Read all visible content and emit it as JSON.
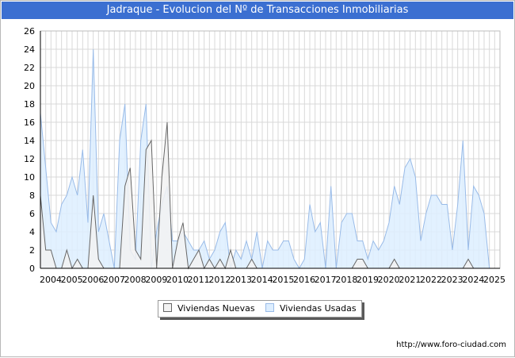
{
  "title": "Jadraque - Evolucion del Nº de Transacciones Inmobiliarias",
  "footer": "http://www.foro-ciudad.com",
  "colors": {
    "title_bg": "#3b6fd1",
    "nuevas_fill": "#f2f2f2",
    "nuevas_line": "#666666",
    "usadas_fill": "#ddeeff",
    "usadas_line": "#99bbe8",
    "grid": "#d9d9d9"
  },
  "chart_data": {
    "type": "area",
    "title": "Jadraque - Evolucion del Nº de Transacciones Inmobiliarias",
    "xlabel": "",
    "ylabel": "",
    "ylim": [
      0,
      26
    ],
    "yticks": [
      0,
      2,
      4,
      6,
      8,
      10,
      12,
      14,
      16,
      18,
      20,
      22,
      24,
      26
    ],
    "xlim": [
      2004,
      2025.75
    ],
    "xticks": [
      "2004",
      "2005",
      "2006",
      "2007",
      "2008",
      "2009",
      "2010",
      "2011",
      "2012",
      "2013",
      "2014",
      "2015",
      "2016",
      "2017",
      "2018",
      "2019",
      "2020",
      "2021",
      "2022",
      "2023",
      "2024",
      "2025"
    ],
    "grid": true,
    "legend_position": "bottom",
    "series": [
      {
        "name": "Viviendas Nuevas",
        "x": [
          2004,
          2004.25,
          2004.5,
          2004.75,
          2005,
          2005.25,
          2005.5,
          2005.75,
          2006,
          2006.25,
          2006.5,
          2006.75,
          2007,
          2007.25,
          2007.5,
          2007.75,
          2008,
          2008.25,
          2008.5,
          2008.75,
          2009,
          2009.25,
          2009.5,
          2009.75,
          2010,
          2010.25,
          2010.5,
          2010.75,
          2011,
          2011.25,
          2011.5,
          2011.75,
          2012,
          2012.25,
          2012.5,
          2012.75,
          2013,
          2013.25,
          2013.5,
          2013.75,
          2014,
          2014.25,
          2014.5,
          2014.75,
          2015,
          2015.25,
          2015.5,
          2015.75,
          2016,
          2016.25,
          2016.5,
          2016.75,
          2017,
          2017.25,
          2017.5,
          2017.75,
          2018,
          2018.25,
          2018.5,
          2018.75,
          2019,
          2019.25,
          2019.5,
          2019.75,
          2020,
          2020.25,
          2020.5,
          2020.75,
          2021,
          2021.25,
          2021.5,
          2021.75,
          2022,
          2022.25,
          2022.5,
          2022.75,
          2023,
          2023.25,
          2023.5,
          2023.75,
          2024,
          2024.25,
          2024.5,
          2024.75,
          2025,
          2025.25,
          2025.5,
          2025.75
        ],
        "values": [
          8,
          2,
          2,
          0,
          0,
          2,
          0,
          1,
          0,
          0,
          8,
          1,
          0,
          0,
          0,
          0,
          9,
          11,
          2,
          1,
          13,
          14,
          0,
          10,
          16,
          0,
          3,
          5,
          0,
          1,
          2,
          0,
          1,
          0,
          1,
          0,
          2,
          0,
          0,
          0,
          1,
          0,
          0,
          0,
          0,
          0,
          0,
          0,
          0,
          0,
          0,
          0,
          0,
          0,
          0,
          0,
          0,
          0,
          0,
          0,
          1,
          1,
          0,
          0,
          0,
          0,
          0,
          1,
          0,
          0,
          0,
          0,
          0,
          0,
          0,
          0,
          0,
          0,
          0,
          0,
          0,
          1,
          0,
          0,
          0,
          0,
          0,
          0
        ]
      },
      {
        "name": "Viviendas Usadas",
        "x": [
          2004,
          2004.25,
          2004.5,
          2004.75,
          2005,
          2005.25,
          2005.5,
          2005.75,
          2006,
          2006.25,
          2006.5,
          2006.75,
          2007,
          2007.25,
          2007.5,
          2007.75,
          2008,
          2008.25,
          2008.5,
          2008.75,
          2009,
          2009.25,
          2009.5,
          2009.75,
          2010,
          2010.25,
          2010.5,
          2010.75,
          2011,
          2011.25,
          2011.5,
          2011.75,
          2012,
          2012.25,
          2012.5,
          2012.75,
          2013,
          2013.25,
          2013.5,
          2013.75,
          2014,
          2014.25,
          2014.5,
          2014.75,
          2015,
          2015.25,
          2015.5,
          2015.75,
          2016,
          2016.25,
          2016.5,
          2016.75,
          2017,
          2017.25,
          2017.5,
          2017.75,
          2018,
          2018.25,
          2018.5,
          2018.75,
          2019,
          2019.25,
          2019.5,
          2019.75,
          2020,
          2020.25,
          2020.5,
          2020.75,
          2021,
          2021.25,
          2021.5,
          2021.75,
          2022,
          2022.25,
          2022.5,
          2022.75,
          2023,
          2023.25,
          2023.5,
          2023.75,
          2024,
          2024.25,
          2024.5,
          2024.75,
          2025,
          2025.25,
          2025.5,
          2025.75
        ],
        "values": [
          17,
          11,
          5,
          4,
          7,
          8,
          10,
          8,
          13,
          5,
          24,
          4,
          6,
          3,
          0,
          14,
          18,
          2,
          1,
          14,
          18,
          0,
          4,
          7,
          9,
          3,
          3,
          4,
          3,
          2,
          2,
          3,
          1,
          2,
          4,
          5,
          0,
          2,
          1,
          3,
          1,
          4,
          0,
          3,
          2,
          2,
          3,
          3,
          1,
          0,
          1,
          7,
          4,
          5,
          0,
          9,
          0,
          5,
          6,
          6,
          3,
          3,
          1,
          3,
          2,
          3,
          5,
          9,
          7,
          11,
          12,
          10,
          3,
          6,
          8,
          8,
          7,
          7,
          2,
          7,
          14,
          2,
          9,
          8,
          6,
          0,
          0,
          0
        ]
      }
    ]
  },
  "legend": {
    "nuevas": "Viviendas Nuevas",
    "usadas": "Viviendas Usadas"
  }
}
